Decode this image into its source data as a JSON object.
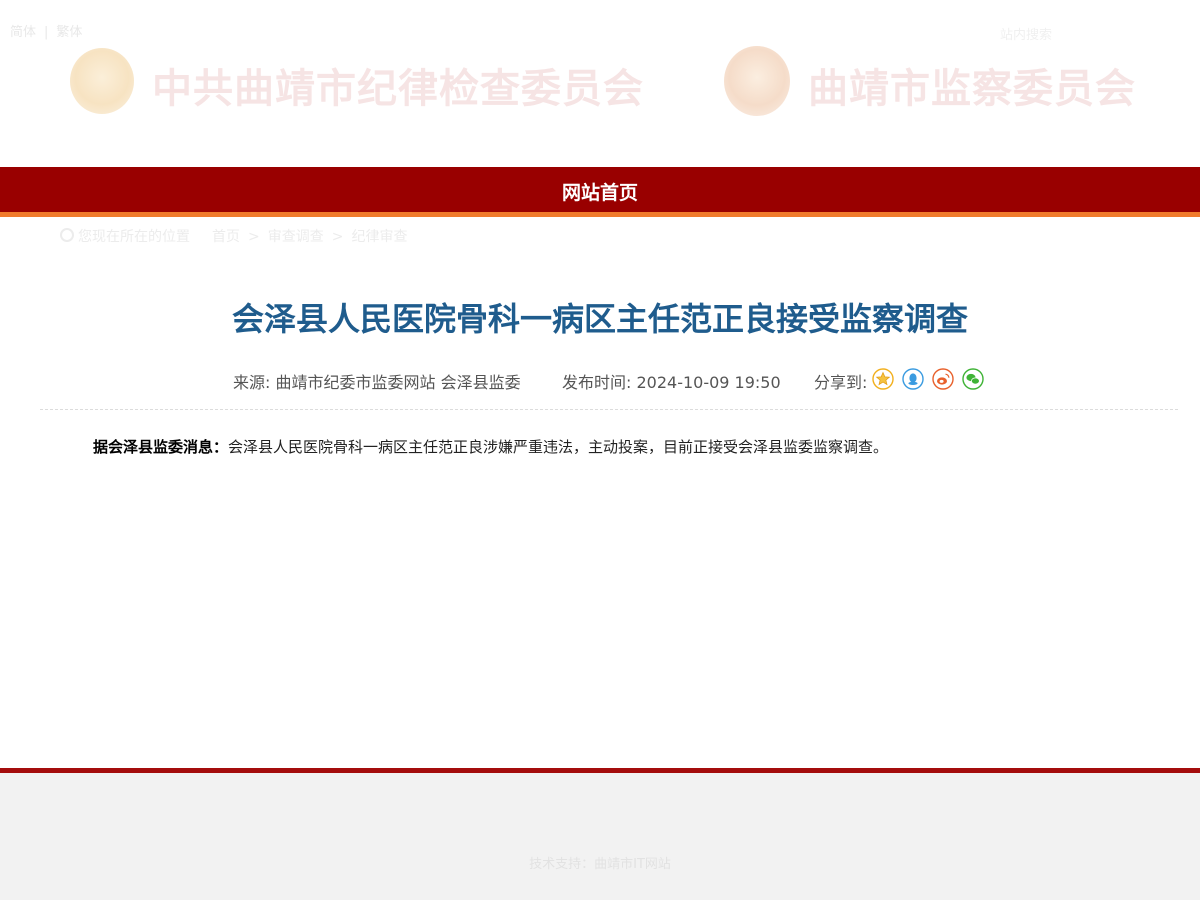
{
  "header": {
    "lang_simplified": "简体",
    "lang_traditional": "繁体",
    "search_hint": "站内搜索",
    "org_left": "中共曲靖市纪律检查委员会",
    "org_right": "曲靖市监察委员会"
  },
  "nav": {
    "home_label": "网站首页"
  },
  "breadcrumb": {
    "prefix": "您现在所在的位置",
    "items": [
      "首页",
      "审查调查",
      "纪律审查"
    ],
    "separator": ">"
  },
  "article": {
    "title": "会泽县人民医院骨科一病区主任范正良接受监察调查",
    "source": "来源: 曲靖市纪委市监委网站 会泽县监委",
    "publish_time": "发布时间: 2024-10-09 19:50",
    "share_label": "分享到:",
    "share_icons": [
      "favorite-star-icon",
      "qq-icon",
      "weibo-icon",
      "wechat-icon"
    ],
    "lead": "据会泽县监委消息：",
    "body": "会泽县人民医院骨科一病区主任范正良涉嫌严重违法，主动投案，目前正接受会泽县监委监察调查。"
  },
  "footer": {
    "support_text": "技术支持：曲靖市IT网站"
  },
  "colors": {
    "nav_background": "#990000",
    "nav_underline": "#f07b2c",
    "title_blue": "#1f5c8d",
    "footer_line": "#a40d0d",
    "footer_background": "#f2f2f2"
  }
}
